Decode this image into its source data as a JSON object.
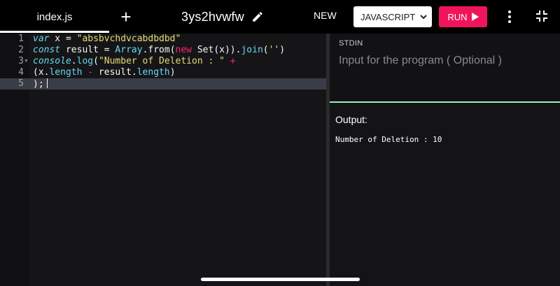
{
  "header": {
    "file_tab": "index.js",
    "add_tab_symbol": "+",
    "project_name": "3ys2hvwfw",
    "new_label": "NEW",
    "language": "JAVASCRIPT",
    "run_label": "RUN"
  },
  "editor": {
    "line_numbers": [
      "1",
      "2",
      "3",
      "4",
      "5"
    ],
    "lines": [
      [
        {
          "t": "var",
          "c": "kw"
        },
        {
          "t": " x = ",
          "c": ""
        },
        {
          "t": "\"absbvchdvcabdbdbd\"",
          "c": "str"
        }
      ],
      [
        {
          "t": "const",
          "c": "kw"
        },
        {
          "t": " result = ",
          "c": ""
        },
        {
          "t": "Array",
          "c": "fn"
        },
        {
          "t": ".from(",
          "c": ""
        },
        {
          "t": "new",
          "c": "kw2"
        },
        {
          "t": " Set(x)).",
          "c": ""
        },
        {
          "t": "join",
          "c": "fn"
        },
        {
          "t": "(",
          "c": ""
        },
        {
          "t": "''",
          "c": "str"
        },
        {
          "t": ")",
          "c": ""
        }
      ],
      [
        {
          "t": "console",
          "c": "kw"
        },
        {
          "t": ".",
          "c": ""
        },
        {
          "t": "log",
          "c": "fn"
        },
        {
          "t": "(",
          "c": ""
        },
        {
          "t": "\"Number of Deletion : \"",
          "c": "str"
        },
        {
          "t": " ",
          "c": ""
        },
        {
          "t": "+",
          "c": "kw2"
        }
      ],
      [
        {
          "t": "(x.",
          "c": ""
        },
        {
          "t": "length",
          "c": "fn"
        },
        {
          "t": " ",
          "c": ""
        },
        {
          "t": "-",
          "c": "kw2"
        },
        {
          "t": " result.",
          "c": ""
        },
        {
          "t": "length",
          "c": "fn"
        },
        {
          "t": ")",
          "c": ""
        }
      ],
      [
        {
          "t": ");",
          "c": ""
        }
      ]
    ]
  },
  "stdin": {
    "label": "STDIN",
    "placeholder": "Input for the program ( Optional )"
  },
  "output": {
    "label": "Output:",
    "text": "Number of Deletion : 10"
  },
  "colors": {
    "run_button": "#f0155a",
    "separator": "#9ef0b6"
  },
  "icons": [
    "plus-icon",
    "pencil-icon",
    "chevron-down-icon",
    "play-icon",
    "kebab-menu-icon",
    "collapse-icon"
  ]
}
